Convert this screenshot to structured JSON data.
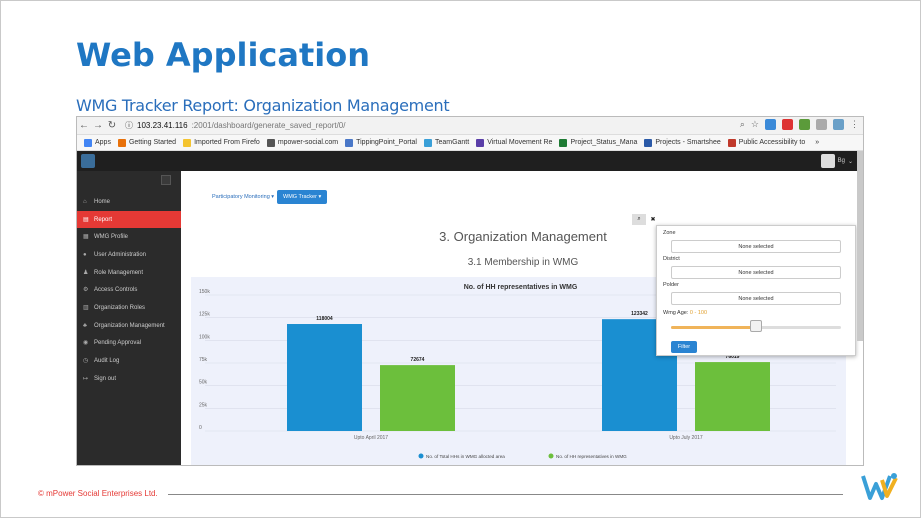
{
  "slide": {
    "title": "Web Application",
    "subtitle": "WMG Tracker Report: Organization Management",
    "footer": "© mPower Social Enterprises Ltd."
  },
  "browser": {
    "url_host": "103.23.41.116",
    "url_path": ":2001/dashboard/generate_saved_report/0/",
    "bookmarks": [
      {
        "label": "Apps",
        "color": "#4285f4"
      },
      {
        "label": "Getting Started",
        "color": "#e8710a"
      },
      {
        "label": "Imported From Firefo",
        "color": "#f4c430"
      },
      {
        "label": "mpower-social.com",
        "color": "#555555"
      },
      {
        "label": "TippingPoint_Portal",
        "color": "#4a78c8"
      },
      {
        "label": "TeamGantt",
        "color": "#3aa0d8"
      },
      {
        "label": "Virtual Movement Re",
        "color": "#5a3ea8"
      },
      {
        "label": "Project_Status_Mana",
        "color": "#1e7b34"
      },
      {
        "label": "Projects - Smartshee",
        "color": "#2b5aa8"
      },
      {
        "label": "Public Accessibility to",
        "color": "#c0392b"
      }
    ],
    "more_label": "»"
  },
  "app": {
    "user_label": "Bg",
    "menu": [
      {
        "label": "Home",
        "icon": "home-icon",
        "glyph": "⌂",
        "active": false
      },
      {
        "label": "Report",
        "icon": "report-icon",
        "glyph": "▤",
        "active": true
      },
      {
        "label": "WMG Profile",
        "icon": "grid-icon",
        "glyph": "▦",
        "active": false
      },
      {
        "label": "User Administration",
        "icon": "user-icon",
        "glyph": "●",
        "active": false
      },
      {
        "label": "Role Management",
        "icon": "users-icon",
        "glyph": "♟",
        "active": false
      },
      {
        "label": "Access Controls",
        "icon": "gears-icon",
        "glyph": "⚙",
        "active": false
      },
      {
        "label": "Organization Roles",
        "icon": "list-icon",
        "glyph": "▥",
        "active": false
      },
      {
        "label": "Organization Management",
        "icon": "sitemap-icon",
        "glyph": "♣",
        "active": false
      },
      {
        "label": "Pending Approval",
        "icon": "eye-icon",
        "glyph": "◉",
        "active": false
      },
      {
        "label": "Audit Log",
        "icon": "clock-icon",
        "glyph": "◷",
        "active": false
      },
      {
        "label": "Sign out",
        "icon": "signout-icon",
        "glyph": "↦",
        "active": false
      }
    ],
    "dropdowns": {
      "participatory": "Participatory Monitoring ▾",
      "wmg_tracker": "WMG Tracker ▾"
    },
    "report_title": "3. Organization Management",
    "report_subtitle": "3.1 Membership in WMG"
  },
  "filter": {
    "zone_label": "Zone",
    "zone_value": "None selected",
    "district_label": "District",
    "district_value": "None selected",
    "polder_label": "Polder",
    "polder_value": "None selected",
    "age_label": "Wmg Age:",
    "age_value": "0 - 100",
    "age_fraction": 0.5,
    "button": "Filter",
    "search_glyph": "🔍",
    "close_glyph": "✖"
  },
  "chart_data": {
    "type": "bar",
    "title": "No. of HH representatives in WMG",
    "categories": [
      "Upto April 2017",
      "Upto July 2017"
    ],
    "series": [
      {
        "name": "No. of Total HHs in WMG allocted area",
        "values": [
          118004,
          123342
        ],
        "color": "#1a8fd1"
      },
      {
        "name": "No. of HH representatives in WMG",
        "values": [
          72674,
          76019
        ],
        "color": "#6cbf3c"
      }
    ],
    "yticks": [
      "0",
      "25k",
      "50k",
      "75k",
      "100k",
      "125k",
      "150k"
    ],
    "ylim": [
      0,
      150000
    ],
    "grid": true,
    "legend": "bottom"
  }
}
